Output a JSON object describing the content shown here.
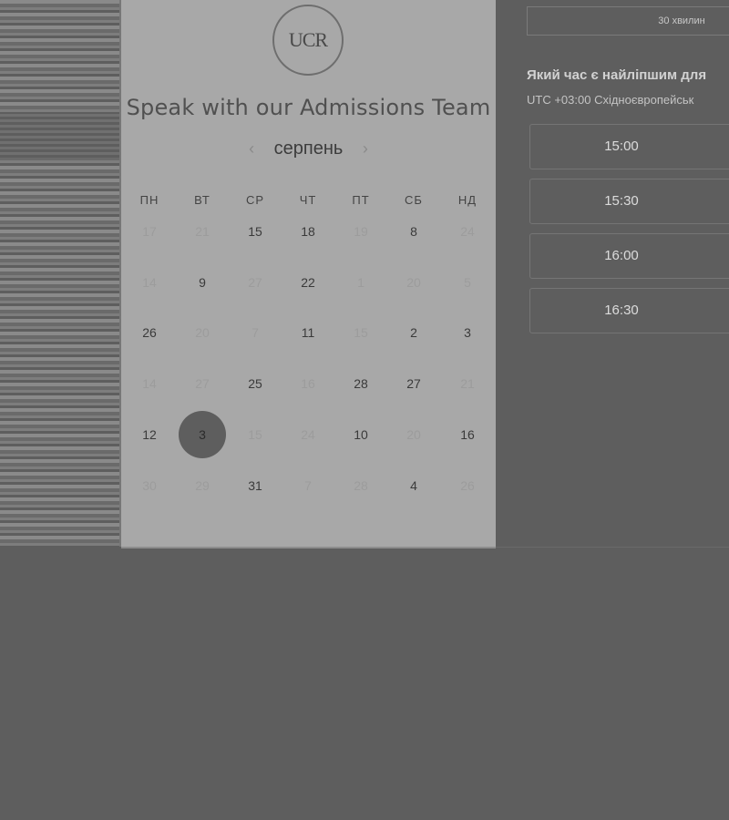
{
  "scheduler": {
    "logo_text": "UCR",
    "title": "Speak with our Admissions Team",
    "month_label": "серпень",
    "prev_arrow": "‹",
    "next_arrow": "›",
    "weekdays": [
      "ПН",
      "ВТ",
      "СР",
      "ЧТ",
      "ПТ",
      "СБ",
      "НД"
    ],
    "weeks": [
      [
        {
          "n": "17",
          "dim": true
        },
        {
          "n": "21",
          "dim": true
        },
        {
          "n": "15",
          "dim": false
        },
        {
          "n": "18",
          "dim": false
        },
        {
          "n": "19",
          "dim": true
        },
        {
          "n": "8",
          "dim": false
        },
        {
          "n": "24",
          "dim": true
        }
      ],
      [
        {
          "n": "14",
          "dim": true
        },
        {
          "n": "9",
          "dim": false
        },
        {
          "n": "27",
          "dim": true
        },
        {
          "n": "22",
          "dim": false
        },
        {
          "n": "1",
          "dim": true
        },
        {
          "n": "20",
          "dim": true
        },
        {
          "n": "5",
          "dim": true
        }
      ],
      [
        {
          "n": "26",
          "dim": false
        },
        {
          "n": "20",
          "dim": true
        },
        {
          "n": "7",
          "dim": true
        },
        {
          "n": "11",
          "dim": false
        },
        {
          "n": "15",
          "dim": true
        },
        {
          "n": "2",
          "dim": false
        },
        {
          "n": "3",
          "dim": false
        }
      ],
      [
        {
          "n": "14",
          "dim": true
        },
        {
          "n": "27",
          "dim": true
        },
        {
          "n": "25",
          "dim": false
        },
        {
          "n": "16",
          "dim": true
        },
        {
          "n": "28",
          "dim": false
        },
        {
          "n": "27",
          "dim": false
        },
        {
          "n": "21",
          "dim": true
        }
      ],
      [
        {
          "n": "12",
          "dim": false
        },
        {
          "n": "3",
          "dim": false,
          "selected": true
        },
        {
          "n": "15",
          "dim": true
        },
        {
          "n": "24",
          "dim": true
        },
        {
          "n": "10",
          "dim": false
        },
        {
          "n": "20",
          "dim": true
        },
        {
          "n": "16",
          "dim": false
        }
      ],
      [
        {
          "n": "30",
          "dim": true
        },
        {
          "n": "29",
          "dim": true
        },
        {
          "n": "31",
          "dim": false
        },
        {
          "n": "7",
          "dim": true
        },
        {
          "n": "28",
          "dim": true
        },
        {
          "n": "4",
          "dim": false
        },
        {
          "n": "26",
          "dim": true
        }
      ]
    ]
  },
  "booking": {
    "duration": "30 хвилин",
    "question": "Який час є найліпшим для",
    "timezone": "UTC +03:00 Східноєвропейськ",
    "slots": [
      "15:00",
      "15:30",
      "16:00",
      "16:30"
    ]
  }
}
